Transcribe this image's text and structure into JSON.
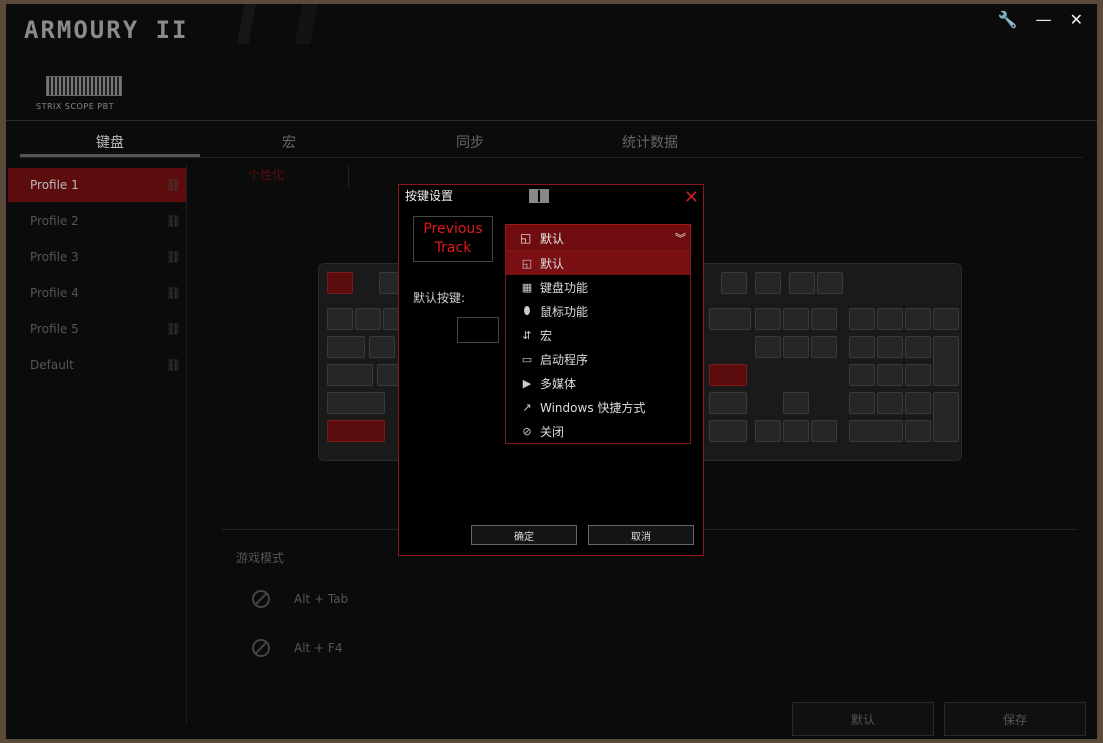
{
  "app": {
    "title": "ARMOURY II"
  },
  "window_controls": {
    "settings": "🔧",
    "minimize": "—",
    "close": "✕"
  },
  "device": {
    "name": "STRIX SCOPE PBT"
  },
  "tabs": [
    {
      "label": "键盘",
      "active": true
    },
    {
      "label": "宏",
      "active": false
    },
    {
      "label": "同步",
      "active": false
    },
    {
      "label": "统计数据",
      "active": false
    }
  ],
  "sub_tab": {
    "label": "个性化"
  },
  "profiles": [
    {
      "label": "Profile 1",
      "active": true
    },
    {
      "label": "Profile 2",
      "active": false
    },
    {
      "label": "Profile 3",
      "active": false
    },
    {
      "label": "Profile 4",
      "active": false
    },
    {
      "label": "Profile 5",
      "active": false
    },
    {
      "label": "Default",
      "active": false
    }
  ],
  "game_mode": {
    "title": "游戏模式",
    "items": [
      {
        "label": "Alt + Tab"
      },
      {
        "label": "Alt + F4"
      }
    ]
  },
  "bottom_buttons": {
    "default_label": "默认",
    "save_label": "保存"
  },
  "dialog": {
    "title": "按键设置",
    "key_name": "Previous Track",
    "selected": "默认",
    "default_key_label": "默认按键:",
    "options": [
      {
        "label": "默认",
        "icon": "default-icon",
        "selected": true
      },
      {
        "label": "键盘功能",
        "icon": "keyboard-icon",
        "selected": false
      },
      {
        "label": "鼠标功能",
        "icon": "mouse-icon",
        "selected": false
      },
      {
        "label": "宏",
        "icon": "macro-icon",
        "selected": false
      },
      {
        "label": "启动程序",
        "icon": "program-icon",
        "selected": false
      },
      {
        "label": "多媒体",
        "icon": "play-icon",
        "selected": false
      },
      {
        "label": "Windows 快捷方式",
        "icon": "shortcut-icon",
        "selected": false
      },
      {
        "label": "关闭",
        "icon": "disable-icon",
        "selected": false
      }
    ],
    "ok_label": "确定",
    "cancel_label": "取消"
  },
  "colors": {
    "accent": "#7a1014",
    "dialog_border": "#8a1a1a",
    "key_text": "#e01a1a"
  }
}
